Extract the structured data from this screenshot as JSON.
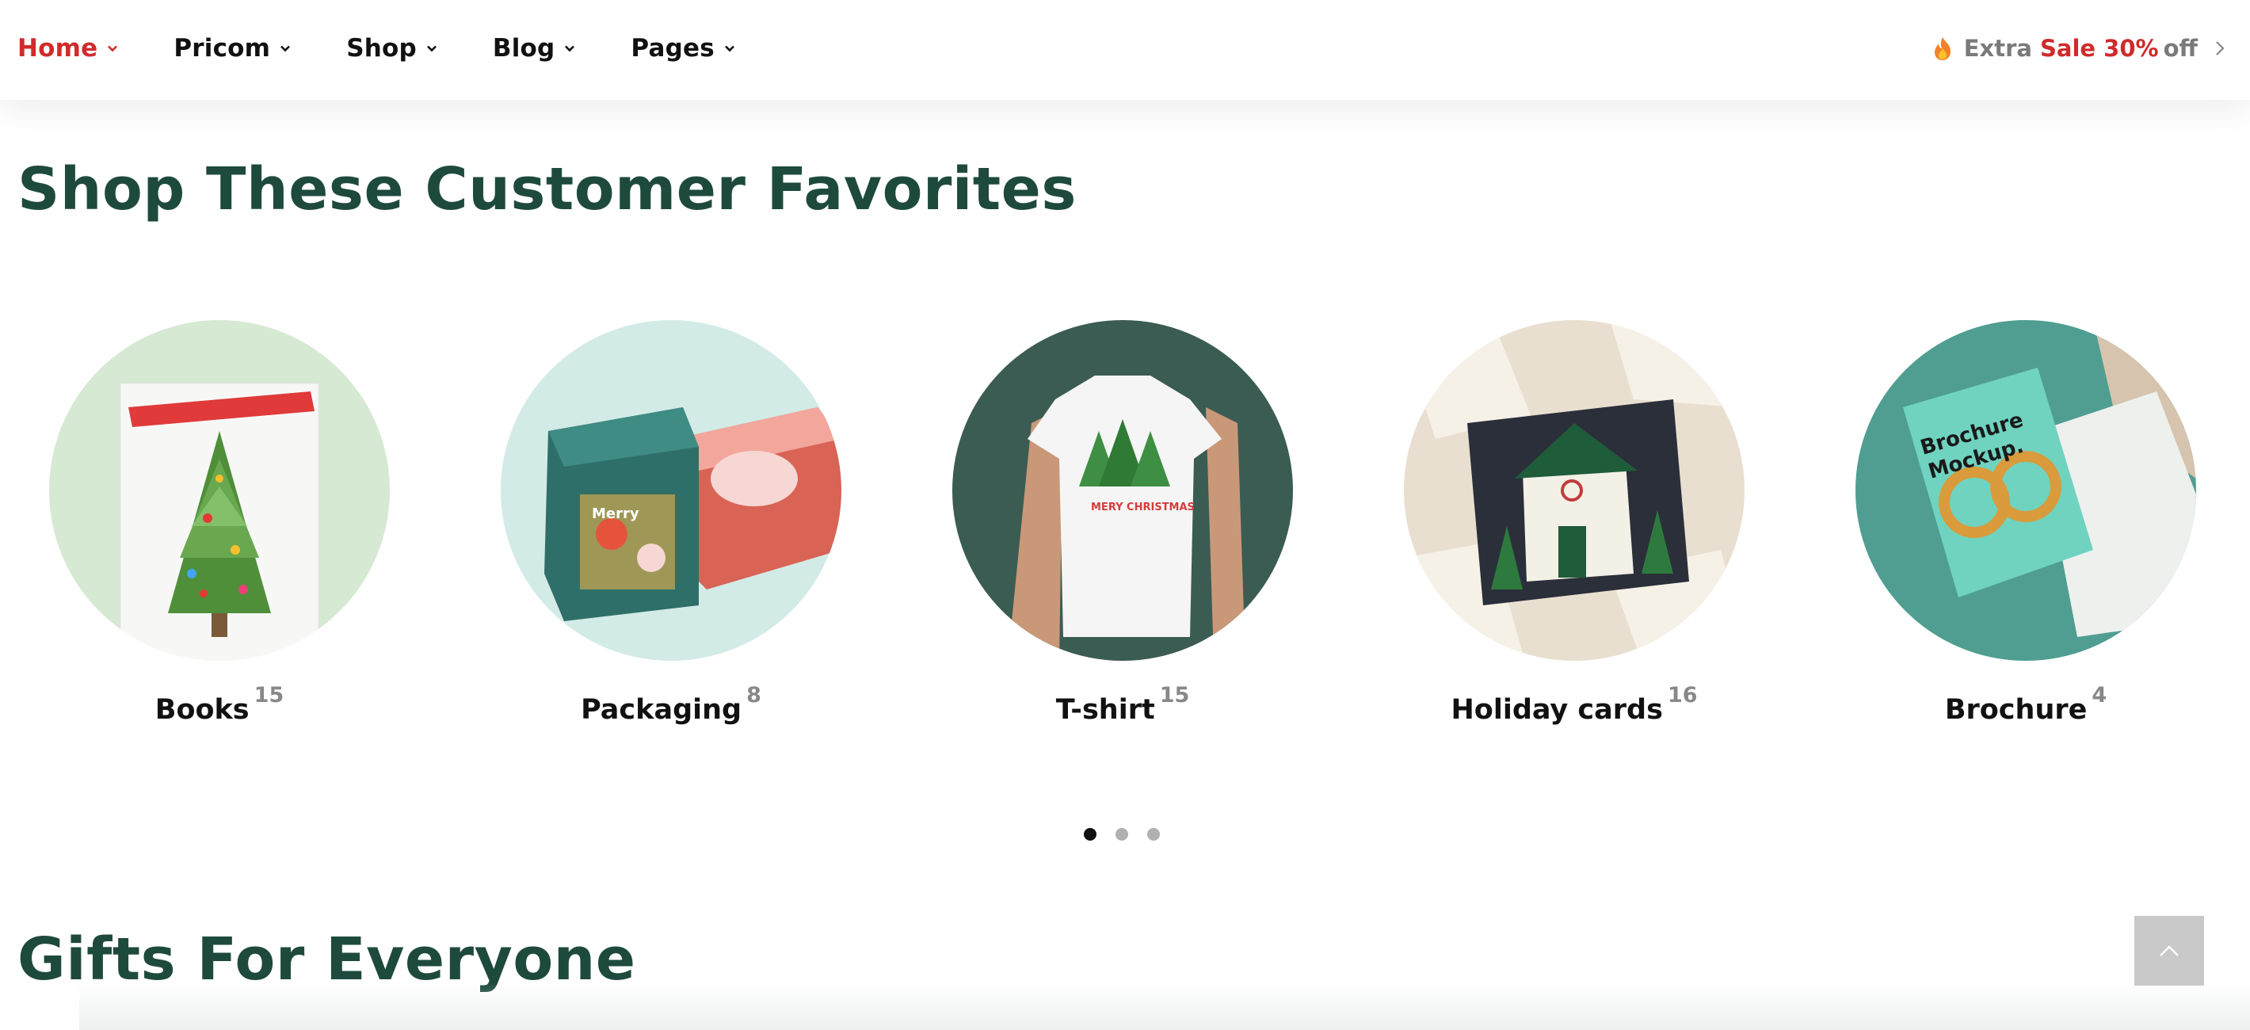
{
  "nav": {
    "items": [
      {
        "label": "Home",
        "active": true
      },
      {
        "label": "Pricom",
        "active": false
      },
      {
        "label": "Shop",
        "active": false
      },
      {
        "label": "Blog",
        "active": false
      },
      {
        "label": "Pages",
        "active": false
      }
    ],
    "promo": {
      "icon": "fire-icon",
      "prefix": "Extra",
      "highlight": "Sale 30%",
      "suffix": "off"
    }
  },
  "section1": {
    "title": "Shop These Customer Favorites",
    "categories": [
      {
        "name": "Books",
        "count": "15"
      },
      {
        "name": "Packaging",
        "count": "8"
      },
      {
        "name": "T-shirt",
        "count": "15"
      },
      {
        "name": "Holiday cards",
        "count": "16"
      },
      {
        "name": "Brochure",
        "count": "4"
      }
    ],
    "carousel": {
      "pages": 3,
      "active_page": 1
    }
  },
  "section2": {
    "title": "Gifts For Everyone"
  },
  "colors": {
    "accent_red": "#d12a2a",
    "heading_green": "#1e4a3d",
    "muted_gray": "#7a7a7a"
  }
}
